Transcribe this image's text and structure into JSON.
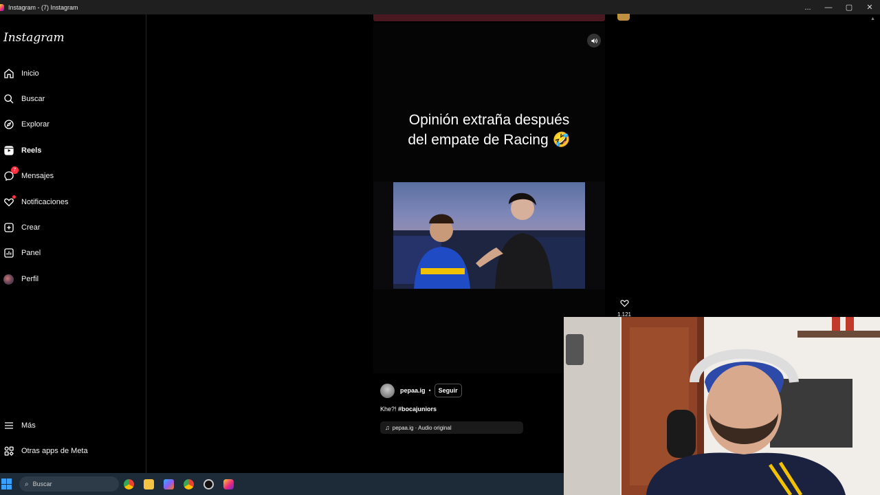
{
  "window": {
    "title": "Instagram - (7) Instagram",
    "controls": [
      "...",
      "—",
      "▢",
      "✕"
    ]
  },
  "sidebar": {
    "logo": "Instagram",
    "items": [
      {
        "label": "Inicio",
        "icon": "home-icon"
      },
      {
        "label": "Buscar",
        "icon": "search-icon"
      },
      {
        "label": "Explorar",
        "icon": "compass-icon"
      },
      {
        "label": "Reels",
        "icon": "reels-icon"
      },
      {
        "label": "Mensajes",
        "icon": "messenger-icon",
        "badge": "7"
      },
      {
        "label": "Notificaciones",
        "icon": "heart-icon"
      },
      {
        "label": "Crear",
        "icon": "plus-square-icon"
      },
      {
        "label": "Panel",
        "icon": "chart-icon"
      },
      {
        "label": "Perfil",
        "icon": "avatar-icon"
      }
    ],
    "bottom": [
      {
        "label": "Más",
        "icon": "menu-icon"
      },
      {
        "label": "Otras apps de Meta",
        "icon": "apps-icon"
      }
    ]
  },
  "reel": {
    "caption_line1": "Opinión extraña después",
    "caption_line2": "del empate de Racing 🤣",
    "likes": "1.121",
    "author": "pepaa.ig",
    "separator": "•",
    "follow_label": "Seguir",
    "description_text": "Khe?! ",
    "description_tag": "#bocajuniors",
    "audio": "pepaa.ig · Audio original"
  },
  "taskbar": {
    "search_label": "Buscar"
  }
}
